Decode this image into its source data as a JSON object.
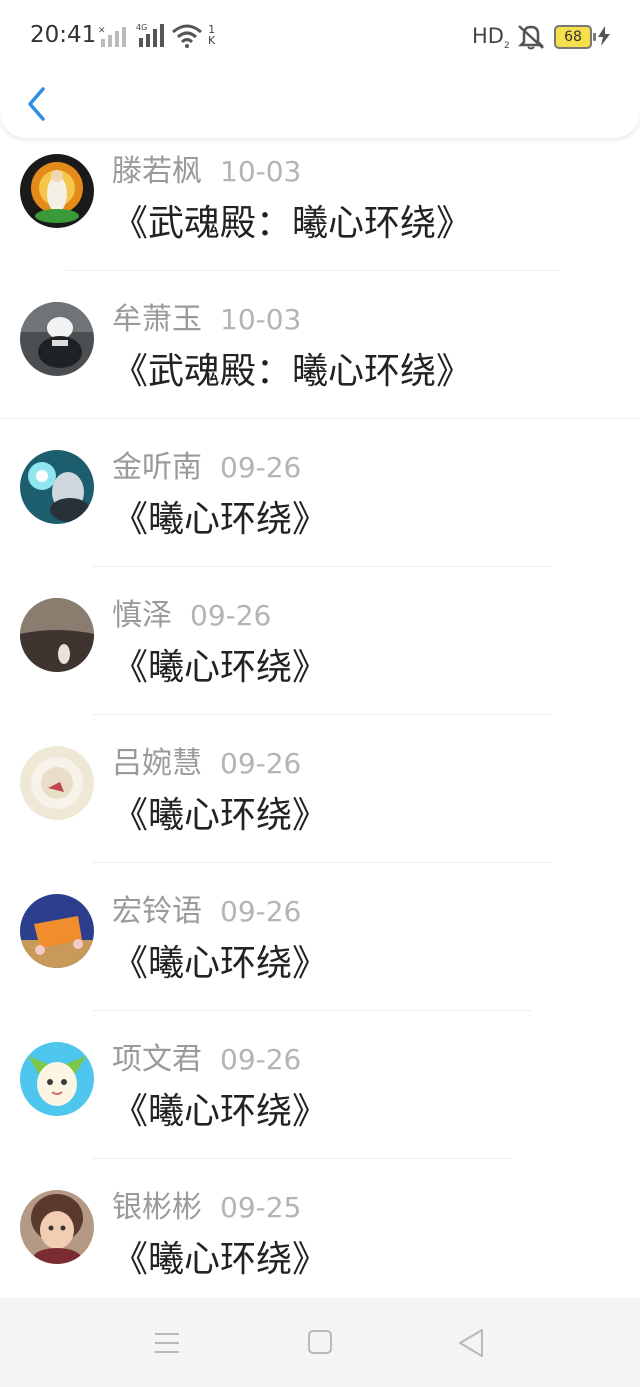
{
  "status_bar": {
    "time": "20:41",
    "net_type": "4G",
    "speed_value": "1",
    "speed_unit": "K",
    "hd_label": "HD",
    "hd_sub": "2",
    "battery_level": "68",
    "icons": [
      "signal-x-icon",
      "signal-4g-icon",
      "wifi-icon",
      "mute-vibrate-icon",
      "battery-icon",
      "charging-icon"
    ]
  },
  "header": {
    "back_icon": "chevron-left-icon",
    "accent_color": "#2b8fe6"
  },
  "comments": [
    {
      "name": "滕若枫",
      "date": "10-03",
      "text": "《武魂殿：曦心环绕》"
    },
    {
      "name": "牟萧玉",
      "date": "10-03",
      "text": "《武魂殿：曦心环绕》"
    },
    {
      "name": "金听南",
      "date": "09-26",
      "text": "《曦心环绕》"
    },
    {
      "name": "慎泽",
      "date": "09-26",
      "text": "《曦心环绕》"
    },
    {
      "name": "吕婉慧",
      "date": "09-26",
      "text": "《曦心环绕》"
    },
    {
      "name": "宏铃语",
      "date": "09-26",
      "text": "《曦心环绕》"
    },
    {
      "name": "项文君",
      "date": "09-26",
      "text": "《曦心环绕》"
    },
    {
      "name": "银彬彬",
      "date": "09-25",
      "text": "《曦心环绕》"
    }
  ],
  "nav_bar": {
    "icons": [
      "menu-icon",
      "home-icon",
      "back-triangle-icon"
    ]
  }
}
